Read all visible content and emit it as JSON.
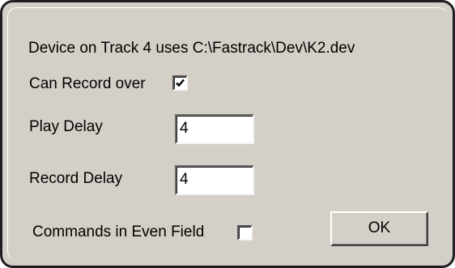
{
  "dialog": {
    "device_line": "Device on Track 4 uses C:\\Fastrack\\Dev\\K2.dev",
    "can_record_over": {
      "label": "Can Record over",
      "checked": true
    },
    "play_delay": {
      "label": "Play Delay",
      "value": "4"
    },
    "record_delay": {
      "label": "Record Delay",
      "value": "4"
    },
    "commands_even_field": {
      "label": "Commands in Even Field",
      "checked": false
    },
    "ok_label": "OK"
  },
  "colors": {
    "dialog_background": "#d4d0c8",
    "field_background": "#ffffff",
    "frame_border": "#1f1f1f"
  }
}
